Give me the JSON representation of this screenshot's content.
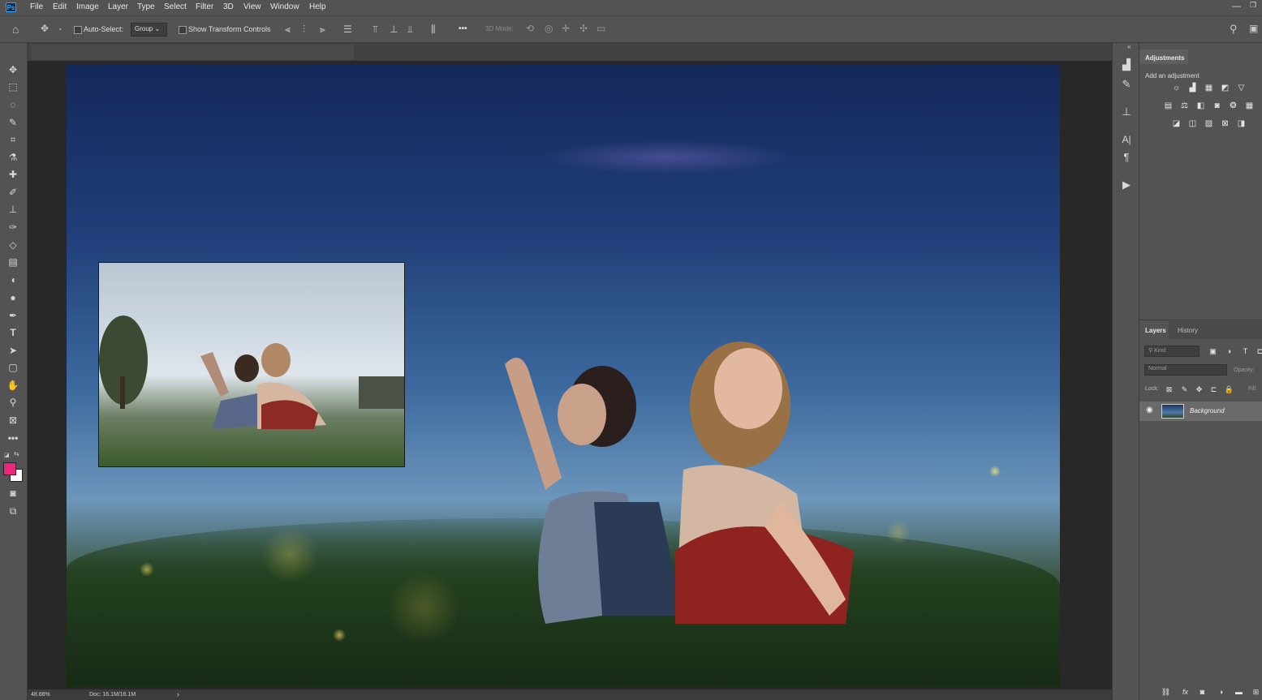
{
  "app": {
    "logo": "Ps"
  },
  "menu": [
    "File",
    "Edit",
    "Image",
    "Layer",
    "Type",
    "Select",
    "Filter",
    "3D",
    "View",
    "Window",
    "Help"
  ],
  "window_controls": {
    "minimize": "—",
    "restore": "❐",
    "close": "✕"
  },
  "options": {
    "auto_select_label": "Auto-Select:",
    "auto_select_target": "Group",
    "show_transform_label": "Show Transform Controls",
    "mode_3d_label": "3D Mode:",
    "more_label": "•••"
  },
  "adjustments_panel": {
    "title": "Adjustments",
    "subtitle": "Add an adjustment"
  },
  "layers_panel": {
    "tabs": [
      "Layers",
      "History"
    ],
    "kind_placeholder": "Kind",
    "blend_mode": "Normal",
    "opacity_label": "Opacity:",
    "lock_label": "Lock:",
    "fill_label": "Fill:",
    "layer_name": "Background"
  },
  "status": {
    "zoom": "48.88%",
    "doc": "Doc: 16.1M/16.1M",
    "arrow": "›"
  },
  "icons": [
    "home-icon",
    "move-icon",
    "marquee-icon",
    "lasso-icon",
    "quick-select-icon",
    "crop-icon",
    "eyedropper-icon",
    "healing-brush-icon",
    "brush-icon",
    "stamp-icon",
    "history-brush-icon",
    "eraser-icon",
    "gradient-icon",
    "blur-icon",
    "dodge-icon",
    "pen-icon",
    "type-icon",
    "path-select-icon",
    "shape-icon",
    "hand-icon",
    "zoom-icon",
    "frame-icon",
    "search-icon",
    "eye-icon"
  ],
  "colors": {
    "foreground": "#e8287a",
    "background": "#ffffff",
    "accent": "#31a8ff"
  }
}
